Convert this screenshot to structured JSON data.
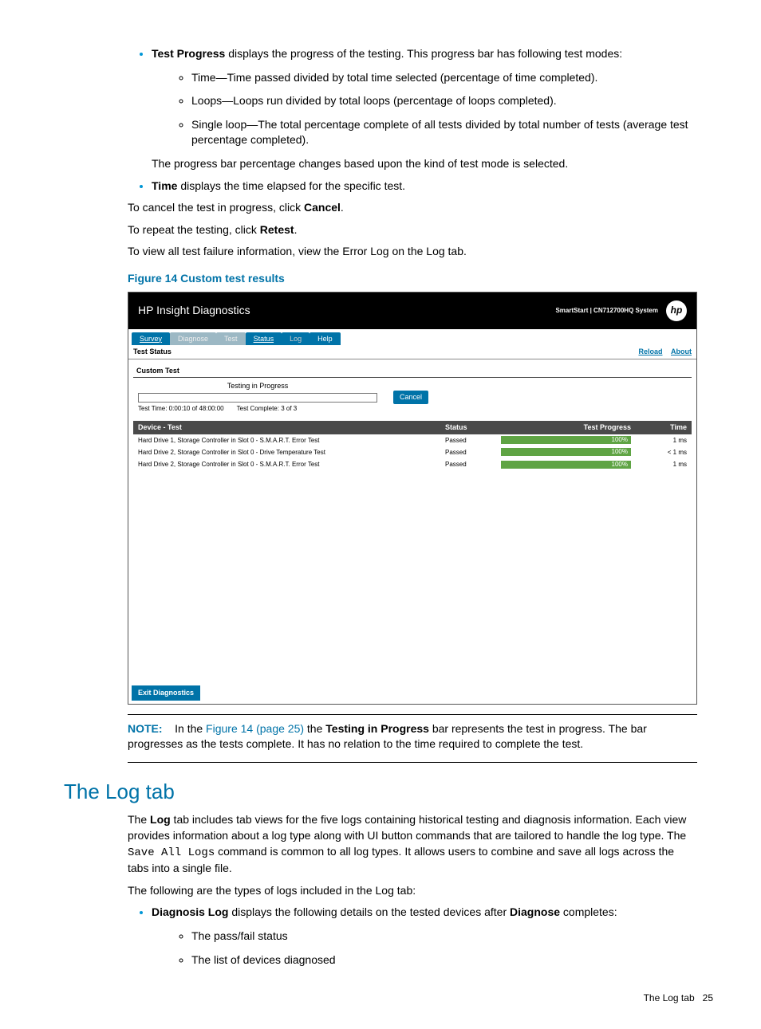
{
  "section1": {
    "bullet1_strong": "Test Progress",
    "bullet1_rest": " displays the progress of the testing. This progress bar has following test modes:",
    "sub1": "Time—Time passed divided by total time selected (percentage of time completed).",
    "sub2": "Loops—Loops run divided by total loops (percentage of loops completed).",
    "sub3": "Single loop—The total percentage complete of all tests divided by total number of tests (average test percentage completed).",
    "after_sub": "The progress bar percentage changes based upon the kind of test mode is selected.",
    "bullet2_strong": "Time",
    "bullet2_rest": " displays the time elapsed for the specific test.",
    "cancel_pre": "To cancel the test in progress, click ",
    "cancel_strong": "Cancel",
    "retest_pre": "To repeat the testing, click ",
    "retest_strong": "Retest",
    "view_err": "To view all test failure information, view the Error Log on the Log tab."
  },
  "figure": {
    "caption": "Figure 14 Custom test results",
    "app_title": "HP Insight Diagnostics",
    "system_label": "SmartStart | CN712700HQ System",
    "logo": "hp",
    "tabs": {
      "survey": "Survey",
      "diagnose": "Diagnose",
      "test": "Test",
      "status": "Status",
      "log": "Log",
      "help": "Help"
    },
    "subheader": "Test Status",
    "links": {
      "reload": "Reload",
      "about": "About"
    },
    "box_title": "Custom Test",
    "progress_label": "Testing in Progress",
    "cancel_btn": "Cancel",
    "meta1": "Test Time: 0:00:10 of 48:00:00",
    "meta2": "Test Complete: 3 of 3",
    "table": {
      "headers": {
        "device": "Device - Test",
        "status": "Status",
        "progress": "Test Progress",
        "time": "Time"
      },
      "rows": [
        {
          "device": "Hard Drive 1, Storage Controller in Slot 0 - S.M.A.R.T. Error Test",
          "status": "Passed",
          "pct": "100%",
          "time": "1 ms"
        },
        {
          "device": "Hard Drive 2, Storage Controller in Slot 0 - Drive Temperature Test",
          "status": "Passed",
          "pct": "100%",
          "time": "< 1 ms"
        },
        {
          "device": "Hard Drive 2, Storage Controller in Slot 0 - S.M.A.R.T. Error Test",
          "status": "Passed",
          "pct": "100%",
          "time": "1 ms"
        }
      ]
    },
    "exit_btn": "Exit Diagnostics"
  },
  "note": {
    "label": "NOTE:",
    "pre": "In the ",
    "link": "Figure 14 (page 25)",
    "mid1": " the ",
    "strong1": "Testing in Progress",
    "rest": " bar represents the test in progress. The bar progresses as the tests complete. It has no relation to the time required to complete the test."
  },
  "logtab": {
    "heading": "The Log tab",
    "p1_pre": "The ",
    "p1_strong": "Log",
    "p1_mid": " tab includes tab views for the five logs containing historical testing and diagnosis information. Each view provides information about a log type along with UI button commands that are tailored to handle the log type. The ",
    "p1_code": "Save All Logs",
    "p1_rest": " command is common to all log types. It allows users to combine and save all logs across the tabs into a single file.",
    "p2": "The following are the types of logs included in the Log tab:",
    "b1_strong": "Diagnosis Log",
    "b1_mid": " displays the following details on the tested devices after ",
    "b1_strong2": "Diagnose",
    "b1_rest": " completes:",
    "sub1": "The pass/fail status",
    "sub2": "The list of devices diagnosed"
  },
  "footer": {
    "label": "The Log tab",
    "page": "25"
  }
}
